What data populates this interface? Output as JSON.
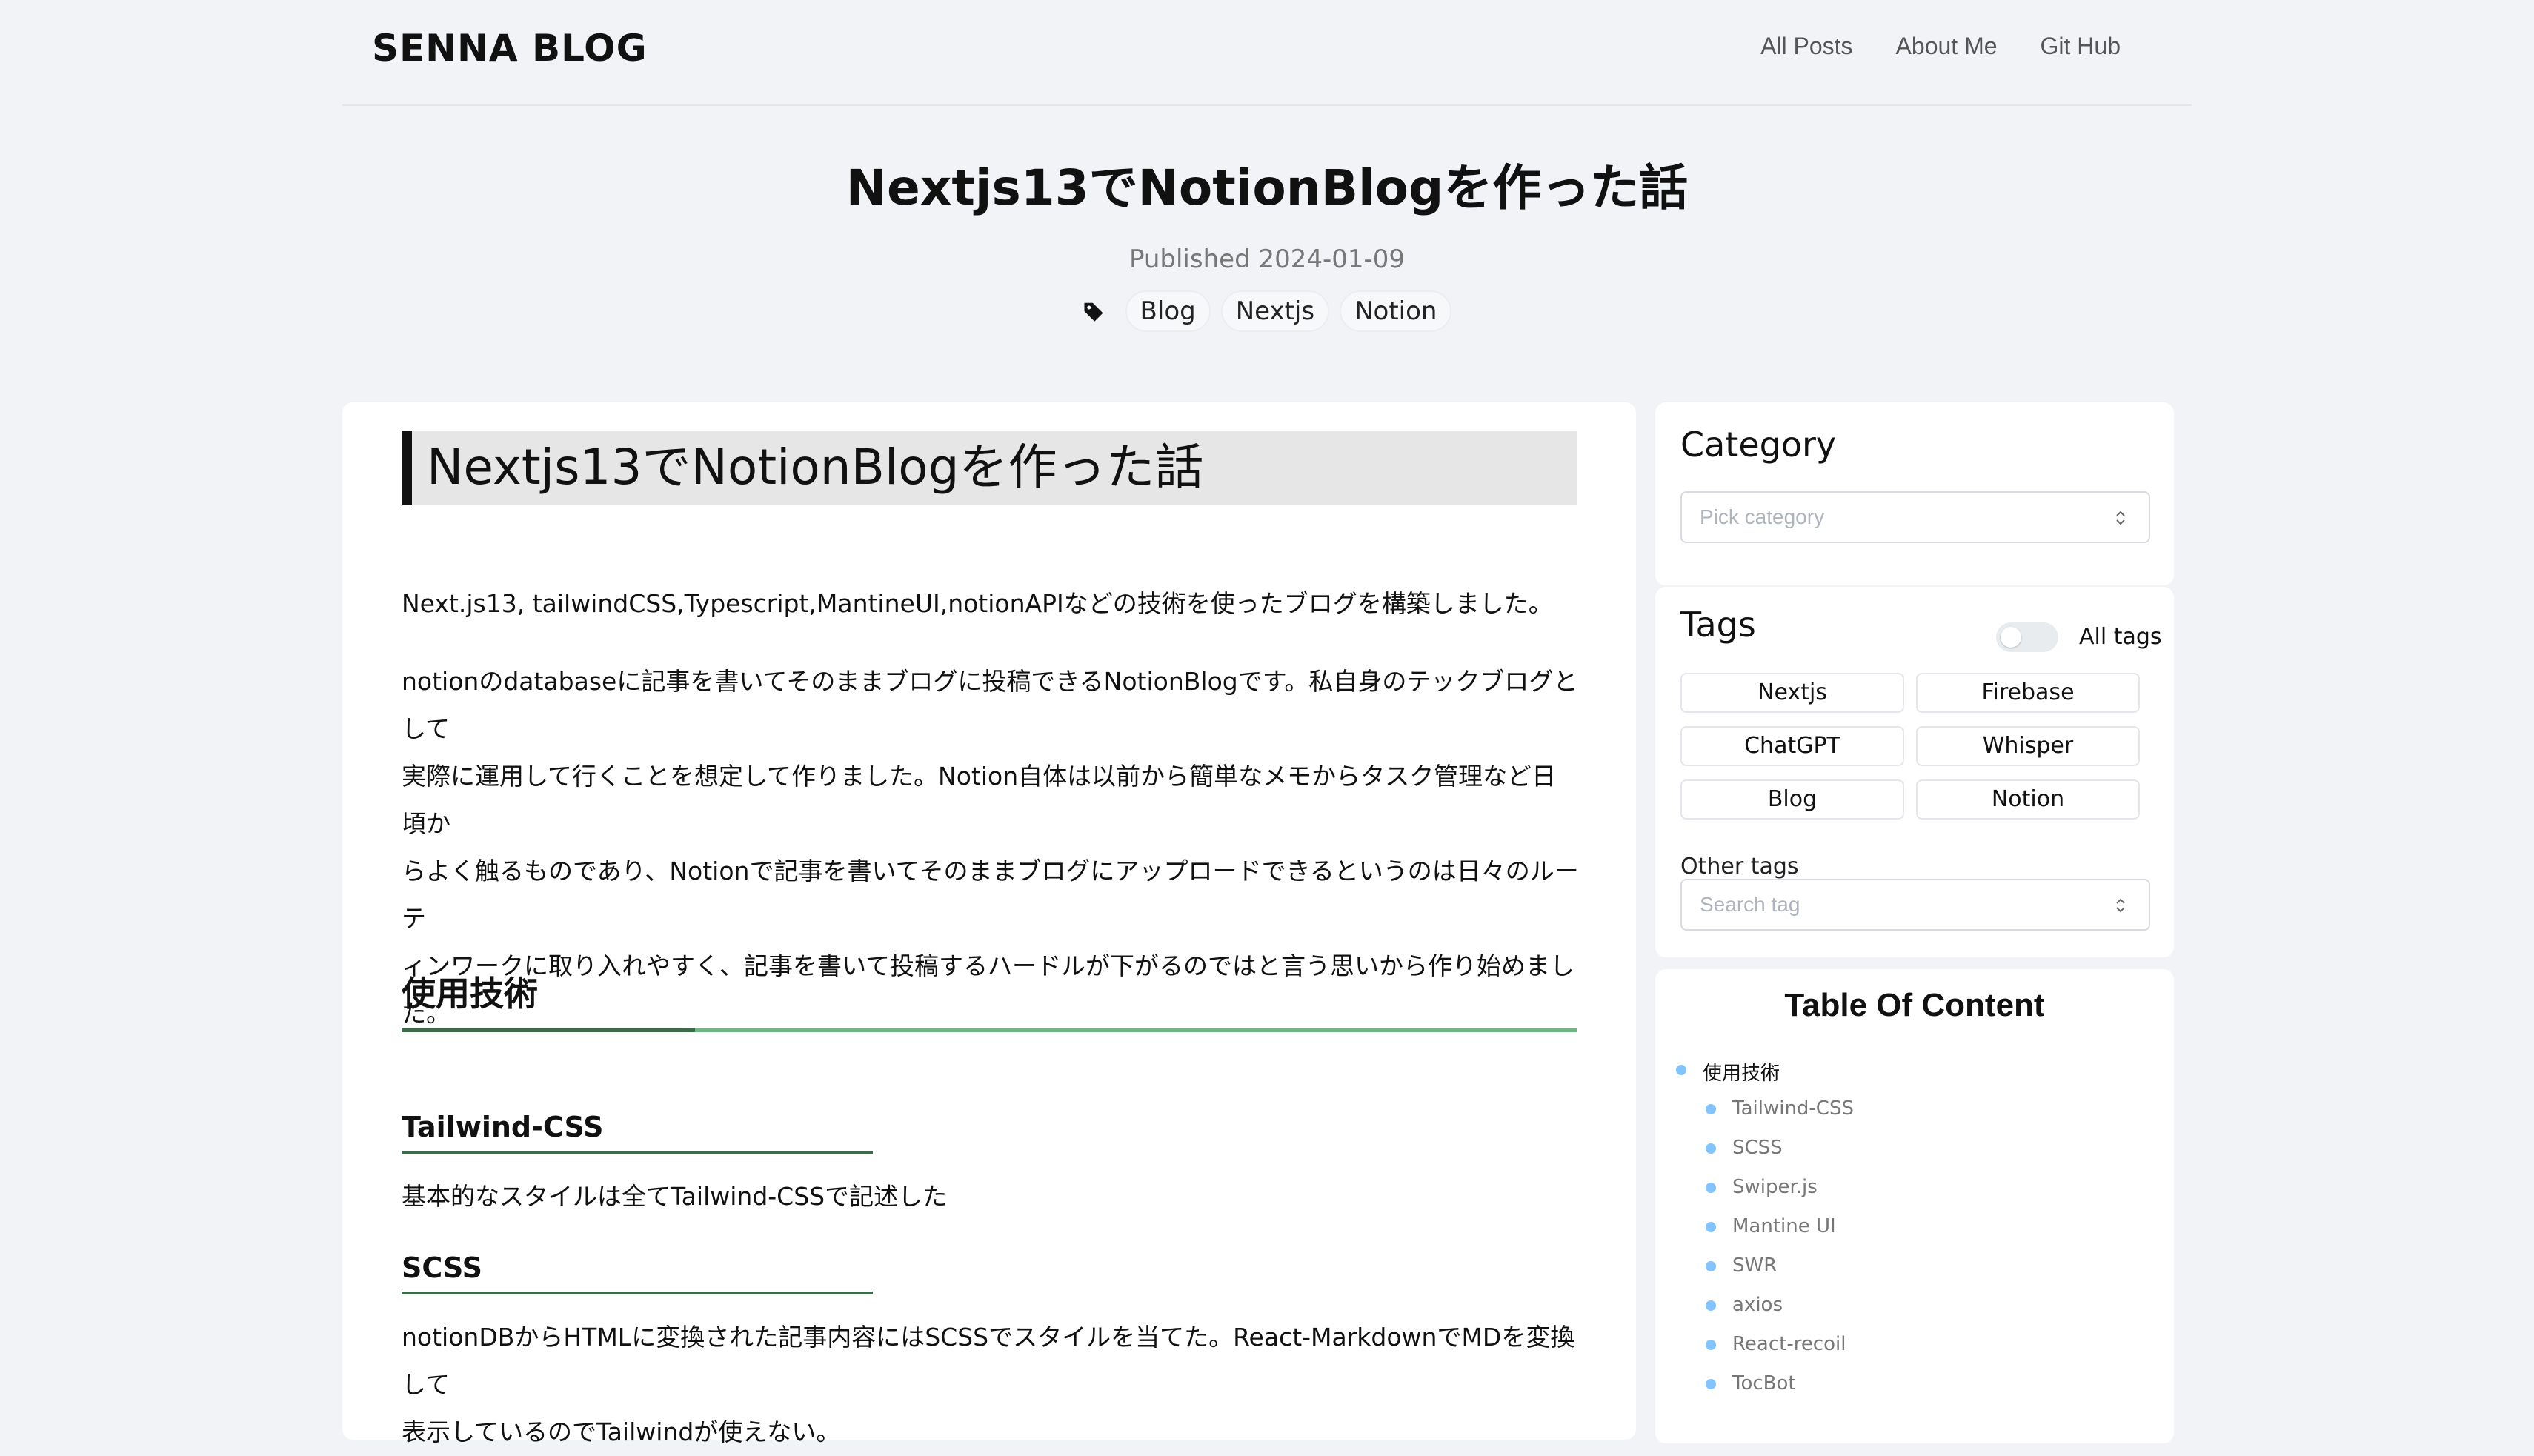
{
  "header": {
    "logo": "SENNA BLOG",
    "nav": [
      "All Posts",
      "About Me",
      "Git Hub"
    ]
  },
  "post": {
    "title": "Nextjs13でNotionBlogを作った話",
    "published": "Published 2024-01-09",
    "tags": [
      "Blog",
      "Nextjs",
      "Notion"
    ]
  },
  "content": {
    "h1": "Nextjs13でNotionBlogを作った話",
    "p1": "Next.js13, tailwindCSS,Typescript,MantineUI,notionAPIなどの技術を使ったブログを構築しました。",
    "p2_lines": [
      "notionのdatabaseに記事を書いてそのままブログに投稿できるNotionBlogです。私自身のテックブログとして",
      "実際に運用して行くことを想定して作りました。Notion自体は以前から簡単なメモからタスク管理など日頃か",
      "らよく触るものであり、Notionで記事を書いてそのままブログにアップロードできるというのは日々のルーテ",
      "ィンワークに取り入れやすく、記事を書いて投稿するハードルが下がるのではと言う思いから作り始めまし",
      "た。"
    ],
    "h2": "使用技術",
    "h3_tailwind": "Tailwind-CSS",
    "p_tailwind": "基本的なスタイルは全てTailwind-CSSで記述した",
    "h3_scss": "SCSS",
    "p_scss_lines": [
      "notionDBからHTMLに変換された記事内容にはSCSSでスタイルを当てた。React-MarkdownでMDを変換して",
      "表示しているのでTailwindが使えない。"
    ]
  },
  "sidebar": {
    "category": {
      "title": "Category",
      "placeholder": "Pick category"
    },
    "tags": {
      "title": "Tags",
      "toggle_label": "All tags",
      "items": [
        "Nextjs",
        "Firebase",
        "ChatGPT",
        "Whisper",
        "Blog",
        "Notion"
      ],
      "other_label": "Other tags",
      "search_placeholder": "Search tag"
    },
    "toc": {
      "title": "Table Of Content",
      "items": [
        "使用技術",
        "Tailwind-CSS",
        "SCSS",
        "Swiper.js",
        "Mantine UI",
        "SWR",
        "axios",
        "React-recoil",
        "TocBot"
      ]
    }
  },
  "colors": {
    "page_bg": "#f1f3f7",
    "heading_underline": "#6fb682",
    "heading_underline_dark": "#3c6b4a",
    "toc_dot": "#82c4ff"
  }
}
